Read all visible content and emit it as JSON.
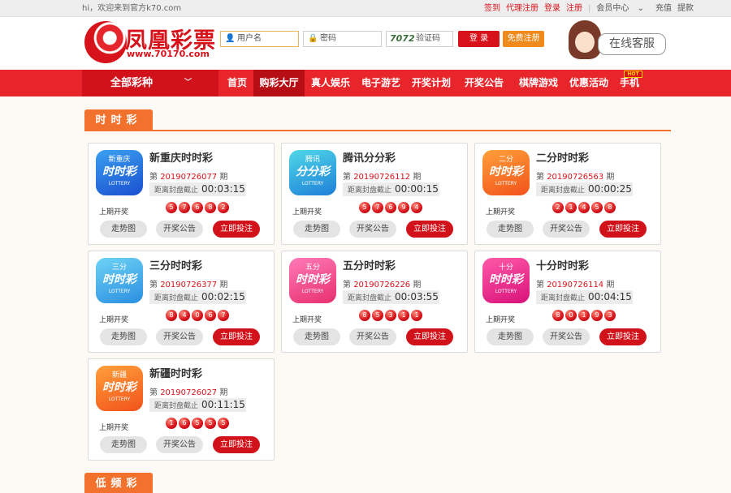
{
  "topbar": {
    "welcome": "hi，欢迎来到官方k70.com",
    "links": [
      "签到",
      "代理注册",
      "登录",
      "注册"
    ],
    "member_center": "会员中心",
    "recharge": "充值",
    "withdraw": "提款"
  },
  "header": {
    "logo_name": "凤凰彩票",
    "logo_url": "www.70170.com",
    "username_placeholder": "用户名",
    "password_placeholder": "密码",
    "captcha_code": "7072",
    "captcha_placeholder": "验证码",
    "login_label": "登 录",
    "register_label": "免费注册",
    "customer_service": "在线客服"
  },
  "nav": {
    "all_games": "全部彩种",
    "items": [
      "首页",
      "购彩大厅",
      "真人娱乐",
      "电子游艺",
      "开奖计划",
      "开奖公告",
      "棋牌游戏",
      "优惠活动",
      "手机"
    ],
    "active_index": 1,
    "hot_badge": "HOT"
  },
  "sections": {
    "ssc_title": "时时彩",
    "lowfreq_title": "低频彩"
  },
  "labels": {
    "issue_prefix": "第",
    "issue_suffix": "期",
    "countdown_label": "距离封盘截止",
    "last_draw": "上期开奖",
    "trend": "走势图",
    "announcement": "开奖公告",
    "bet_now": "立即投注"
  },
  "colors": {
    "brand_red": "#d7121a",
    "nav_red": "#e8252b",
    "section_orange": "#f2712c"
  },
  "lotteries": [
    {
      "name": "新重庆时时彩",
      "issue": "20190726077",
      "countdown": "00:03:15",
      "balls": [
        "5",
        "7",
        "6",
        "8",
        "2"
      ],
      "icon_top": "新重庆",
      "icon_main": "时时彩",
      "icon_sub": "LOTTERY",
      "icon_color": "blue"
    },
    {
      "name": "腾讯分分彩",
      "issue": "20190726112",
      "countdown": "00:00:15",
      "balls": [
        "5",
        "7",
        "6",
        "9",
        "4"
      ],
      "icon_top": "腾讯",
      "icon_main": "分分彩",
      "icon_sub": "LOTTERY",
      "icon_color": "cyan"
    },
    {
      "name": "二分时时彩",
      "issue": "20190726563",
      "countdown": "00:00:25",
      "balls": [
        "2",
        "1",
        "4",
        "5",
        "8"
      ],
      "icon_top": "二分",
      "icon_main": "时时彩",
      "icon_sub": "LOTTERY",
      "icon_color": "orange"
    },
    {
      "name": "三分时时彩",
      "issue": "20190726377",
      "countdown": "00:02:15",
      "balls": [
        "8",
        "4",
        "0",
        "6",
        "7"
      ],
      "icon_top": "三分",
      "icon_main": "时时彩",
      "icon_sub": "LOTTERY",
      "icon_color": "lightblue"
    },
    {
      "name": "五分时时彩",
      "issue": "20190726226",
      "countdown": "00:03:55",
      "balls": [
        "8",
        "5",
        "3",
        "1",
        "1"
      ],
      "icon_top": "五分",
      "icon_main": "时时彩",
      "icon_sub": "LOTTERY",
      "icon_color": "pink"
    },
    {
      "name": "十分时时彩",
      "issue": "20190726114",
      "countdown": "00:04:15",
      "balls": [
        "8",
        "0",
        "1",
        "9",
        "3"
      ],
      "icon_top": "十分",
      "icon_main": "时时彩",
      "icon_sub": "LOTTERY",
      "icon_color": "magenta"
    },
    {
      "name": "新疆时时彩",
      "issue": "20190726027",
      "countdown": "00:11:15",
      "balls": [
        "1",
        "6",
        "5",
        "5",
        "5"
      ],
      "icon_top": "新疆",
      "icon_main": "时时彩",
      "icon_sub": "LOTTERY",
      "icon_color": "orange"
    }
  ]
}
